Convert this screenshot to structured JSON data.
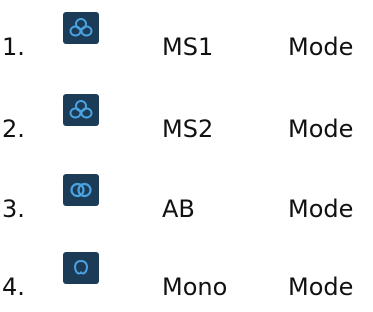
{
  "modes": [
    {
      "number": "1.",
      "name": "MS1",
      "suffix": "Mode",
      "icon": "ms1-mic-pattern-icon"
    },
    {
      "number": "2.",
      "name": "MS2",
      "suffix": "Mode",
      "icon": "ms2-mic-pattern-icon"
    },
    {
      "number": "3.",
      "name": "AB",
      "suffix": "Mode",
      "icon": "ab-mic-pattern-icon"
    },
    {
      "number": "4.",
      "name": "Mono",
      "suffix": "Mode",
      "icon": "mono-mic-pattern-icon"
    }
  ],
  "colors": {
    "icon_bg": "#1b3b57",
    "icon_stroke": "#4aa3e0",
    "text": "#111111"
  }
}
